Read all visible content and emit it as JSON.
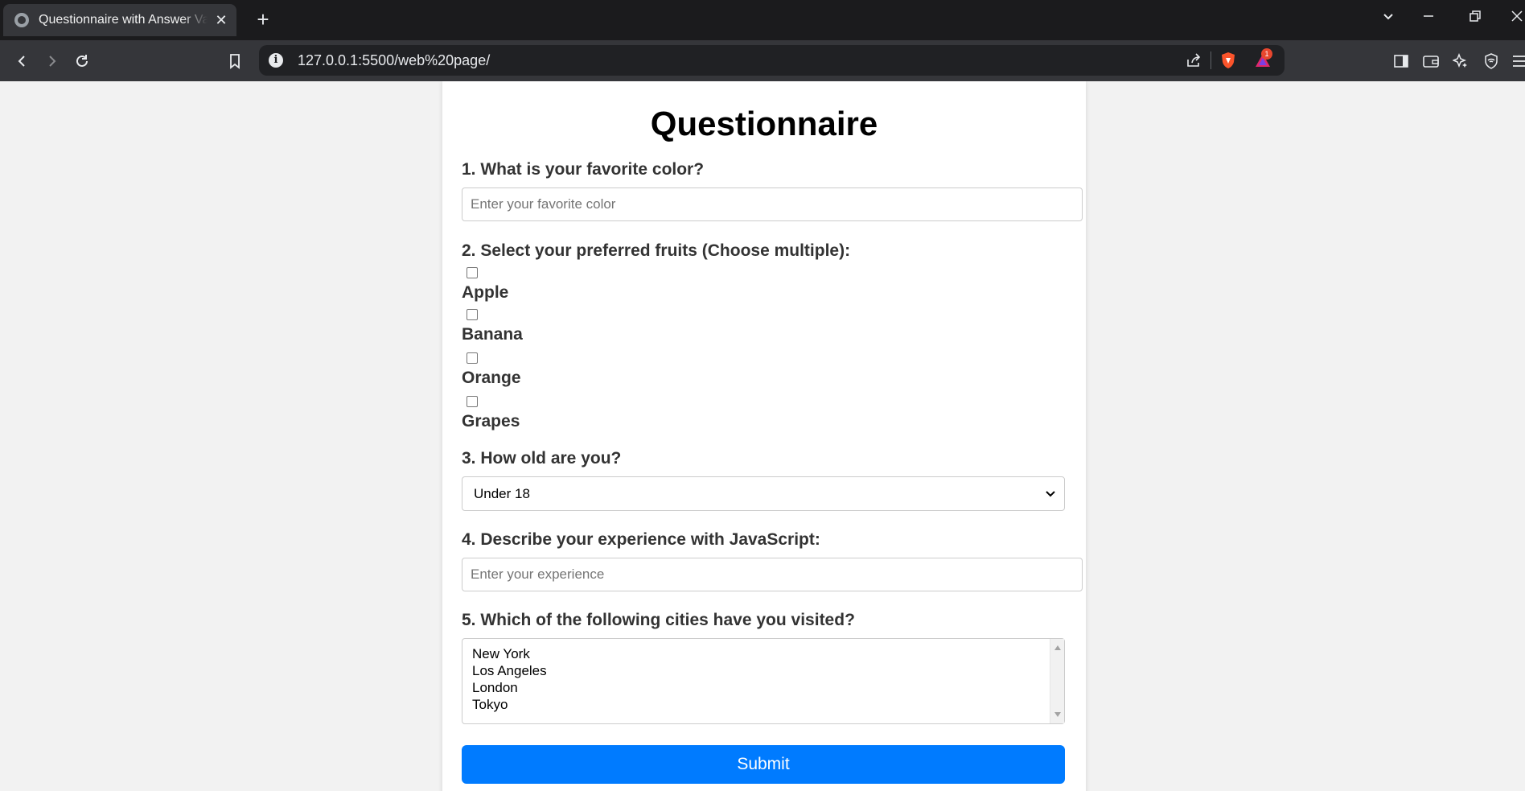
{
  "browser": {
    "tab_title": "Questionnaire with Answer Validation",
    "new_tab_symbol": "+",
    "url": "127.0.0.1:5500/web%20page/",
    "notification_count": "1"
  },
  "page": {
    "title": "Questionnaire",
    "q1": {
      "label": "1. What is your favorite color?",
      "placeholder": "Enter your favorite color"
    },
    "q2": {
      "label": "2. Select your preferred fruits (Choose multiple):",
      "options": [
        "Apple",
        "Banana",
        "Orange",
        "Grapes"
      ]
    },
    "q3": {
      "label": "3. How old are you?",
      "selected": "Under 18"
    },
    "q4": {
      "label": "4. Describe your experience with JavaScript:",
      "placeholder": "Enter your experience"
    },
    "q5": {
      "label": "5. Which of the following cities have you visited?",
      "options": [
        "New York",
        "Los Angeles",
        "London",
        "Tokyo"
      ]
    },
    "submit_label": "Submit"
  },
  "colors": {
    "submit_bg": "#007bff",
    "chrome_dark": "#1b1b1d",
    "toolbar": "#35363a",
    "page_bg": "#f2f2f2"
  }
}
